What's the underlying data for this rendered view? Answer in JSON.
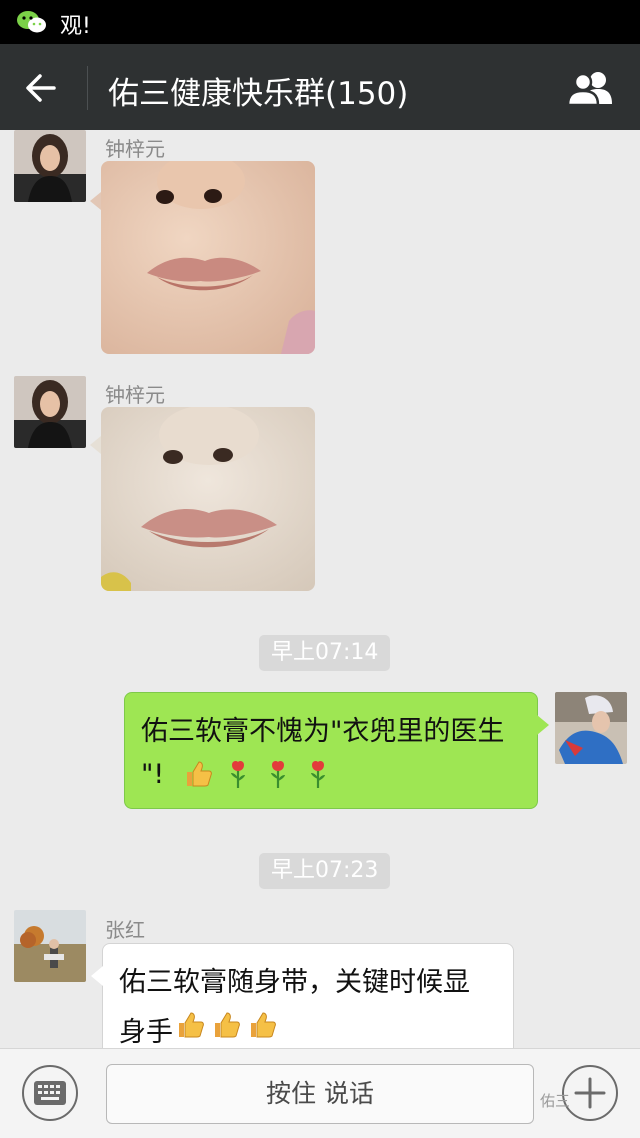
{
  "status_bar": {
    "notification_text": "观!"
  },
  "header": {
    "title": "佑三健康快乐群(150)"
  },
  "messages": [
    {
      "type": "image",
      "sender": "钟梓元",
      "side": "left",
      "avatar": "woman-portrait-avatar"
    },
    {
      "type": "image",
      "sender": "钟梓元",
      "side": "left",
      "avatar": "woman-portrait-avatar"
    },
    {
      "type": "timestamp",
      "time": "早上07:14"
    },
    {
      "type": "text",
      "side": "right",
      "avatar": "costume-portrait-avatar",
      "line1": "佑三软膏不愧为\"衣兜里的医生",
      "line2": "\"!",
      "emojis": [
        "thumbs-up-emoji",
        "rose-emoji",
        "rose-emoji",
        "rose-emoji"
      ]
    },
    {
      "type": "timestamp",
      "time": "早上07:23"
    },
    {
      "type": "text",
      "side": "left",
      "sender": "张红",
      "avatar": "outdoor-photo-avatar",
      "line1": "佑三软膏随身带，关键时候显",
      "line2": "身手",
      "emojis": [
        "thumbs-up-emoji",
        "thumbs-up-emoji",
        "thumbs-up-emoji"
      ]
    }
  ],
  "input_bar": {
    "voice_button_label": "按住 说话"
  },
  "watermark": "佑三",
  "colors": {
    "header": "#2e3132",
    "chat_bg": "#ebebeb",
    "green_bubble": "#9ee653"
  }
}
